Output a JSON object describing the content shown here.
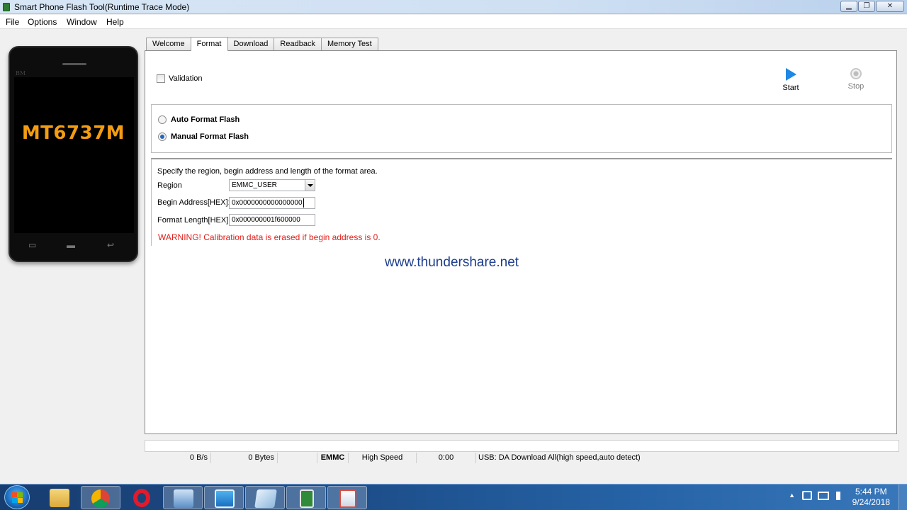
{
  "window": {
    "title": "Smart Phone Flash Tool(Runtime Trace Mode)",
    "minimize": "▁",
    "maximize": "❐",
    "close": "✕"
  },
  "menu": [
    "File",
    "Options",
    "Window",
    "Help"
  ],
  "phone": {
    "chip_label": "MT6737M",
    "brand_text": "BM",
    "buttons": [
      "▭",
      "▬",
      "↩"
    ]
  },
  "tabs": [
    {
      "label": "Welcome",
      "active": false
    },
    {
      "label": "Format",
      "active": true
    },
    {
      "label": "Download",
      "active": false
    },
    {
      "label": "Readback",
      "active": false
    },
    {
      "label": "Memory Test",
      "active": false
    }
  ],
  "format": {
    "validation_label": "Validation",
    "validation_checked": false,
    "start_label": "Start",
    "stop_label": "Stop",
    "auto_format_label": "Auto Format Flash",
    "manual_format_label": "Manual Format Flash",
    "selected_mode": "manual",
    "description": "Specify the region, begin address and length of the format area.",
    "region_label": "Region",
    "region_value": "EMMC_USER",
    "begin_label": "Begin Address[HEX]:",
    "begin_value": "0x0000000000000000",
    "length_label": "Format Length[HEX]:",
    "length_value": "0x000000001f600000",
    "warning": "WARNING! Calibration data is erased if begin address is 0."
  },
  "watermark": "www.thundershare.net",
  "status": {
    "speed": "0 B/s",
    "bytes": "0 Bytes",
    "storage": "EMMC",
    "mode": "High Speed",
    "time": "0:00",
    "usb": "USB: DA Download All(high speed,auto detect)"
  },
  "taskbar": {
    "apps": [
      "file-explorer",
      "chrome",
      "opera",
      "remote-desktop",
      "snipping-tool",
      "notepad",
      "flash-tool",
      "document-viewer"
    ],
    "tray_arrow": "▲",
    "time": "5:44 PM",
    "date": "9/24/2018"
  },
  "colors": {
    "warning": "#e0201b",
    "chip_label": "#f39c12",
    "play": "#1e88e5",
    "taskbar": "#1d4e8a"
  }
}
